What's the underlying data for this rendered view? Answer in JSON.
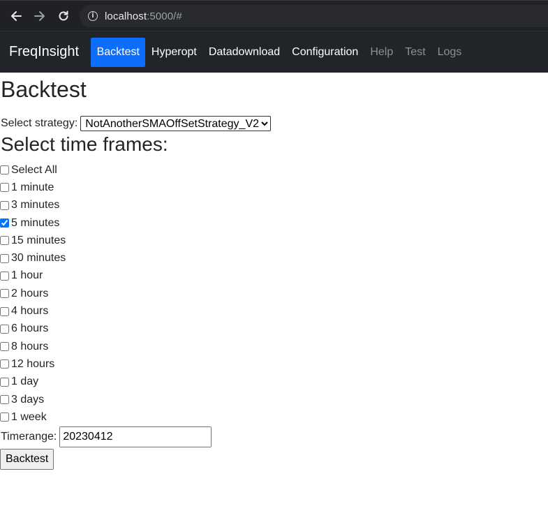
{
  "browser": {
    "url_host": "localhost",
    "url_rest": ":5000/#"
  },
  "navbar": {
    "brand": "FreqInsight",
    "items": [
      {
        "label": "Backtest",
        "state": "active"
      },
      {
        "label": "Hyperopt",
        "state": "light"
      },
      {
        "label": "Datadownload",
        "state": "light"
      },
      {
        "label": "Configuration",
        "state": "light"
      },
      {
        "label": "Help",
        "state": "muted"
      },
      {
        "label": "Test",
        "state": "muted"
      },
      {
        "label": "Logs",
        "state": "muted"
      }
    ]
  },
  "page": {
    "title": "Backtest",
    "strategy_label": "Select strategy:",
    "strategy_value": "NotAnotherSMAOffSetStrategy_V2",
    "timeframes_title": "Select time frames:",
    "timeframes": [
      {
        "label": "Select All",
        "checked": false
      },
      {
        "label": "1 minute",
        "checked": false
      },
      {
        "label": "3 minutes",
        "checked": false
      },
      {
        "label": "5 minutes",
        "checked": true
      },
      {
        "label": "15 minutes",
        "checked": false
      },
      {
        "label": "30 minutes",
        "checked": false
      },
      {
        "label": "1 hour",
        "checked": false
      },
      {
        "label": "2 hours",
        "checked": false
      },
      {
        "label": "4 hours",
        "checked": false
      },
      {
        "label": "6 hours",
        "checked": false
      },
      {
        "label": "8 hours",
        "checked": false
      },
      {
        "label": "12 hours",
        "checked": false
      },
      {
        "label": "1 day",
        "checked": false
      },
      {
        "label": "3 days",
        "checked": false
      },
      {
        "label": "1 week",
        "checked": false
      }
    ],
    "timerange_label": "Timerange:",
    "timerange_value": "20230412",
    "backtest_button": "Backtest"
  },
  "colors": {
    "navbar_bg": "#212529",
    "active_nav": "#0d6efd",
    "browser_bg": "#202124"
  }
}
